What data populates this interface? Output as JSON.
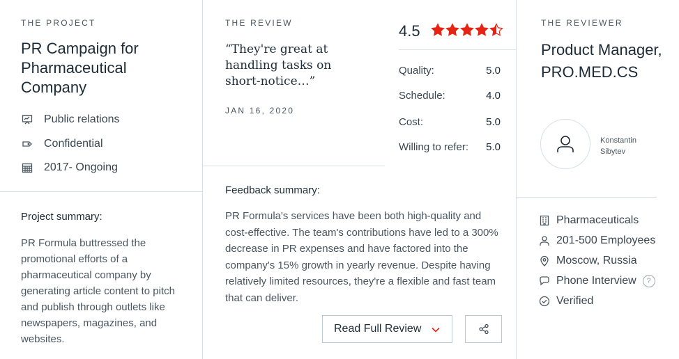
{
  "project": {
    "eyebrow": "THE PROJECT",
    "title": "PR Campaign for Pharmaceutical Company",
    "meta": [
      {
        "icon": "presentation-icon",
        "label": "Public relations"
      },
      {
        "icon": "tag-icon",
        "label": "Confidential"
      },
      {
        "icon": "calendar-icon",
        "label": "2017- Ongoing"
      }
    ],
    "summary_heading": "Project summary:",
    "summary_text": "PR Formula buttressed the promotional efforts of a pharmaceutical company by generating article content to pitch and publish through outlets like newspapers, magazines, and websites."
  },
  "review": {
    "eyebrow": "THE REVIEW",
    "quote": "“They're great at handling tasks on short-notice…”",
    "date": "JAN 16, 2020",
    "overall_rating": "4.5",
    "stars_filled": 4.5,
    "star_color": "#e62415",
    "scores": [
      {
        "label": "Quality:",
        "value": "5.0"
      },
      {
        "label": "Schedule:",
        "value": "4.0"
      },
      {
        "label": "Cost:",
        "value": "5.0"
      },
      {
        "label": "Willing to refer:",
        "value": "5.0"
      }
    ],
    "feedback_heading": "Feedback summary:",
    "feedback_text": "PR Formula's services have been both high-quality and cost-effective. The team's contributions have led to a 300% decrease in PR expenses and have factored into the company's 15% growth in yearly revenue. Despite having relatively limited resources, they're a flexible and fast team that can deliver.",
    "read_full_label": "Read Full Review",
    "share_icon": "share-icon"
  },
  "reviewer": {
    "eyebrow": "THE REVIEWER",
    "title": "Product Manager, PRO.MED.CS",
    "name": "Konstantin Sibytev",
    "info": [
      {
        "icon": "building-icon",
        "label": "Pharmaceuticals"
      },
      {
        "icon": "user-icon",
        "label": "201-500 Employees"
      },
      {
        "icon": "location-pin-icon",
        "label": "Moscow, Russia"
      },
      {
        "icon": "chat-bubble-icon",
        "label": "Phone Interview"
      },
      {
        "icon": "check-circle-icon",
        "label": "Verified"
      }
    ],
    "help_glyph": "?"
  }
}
